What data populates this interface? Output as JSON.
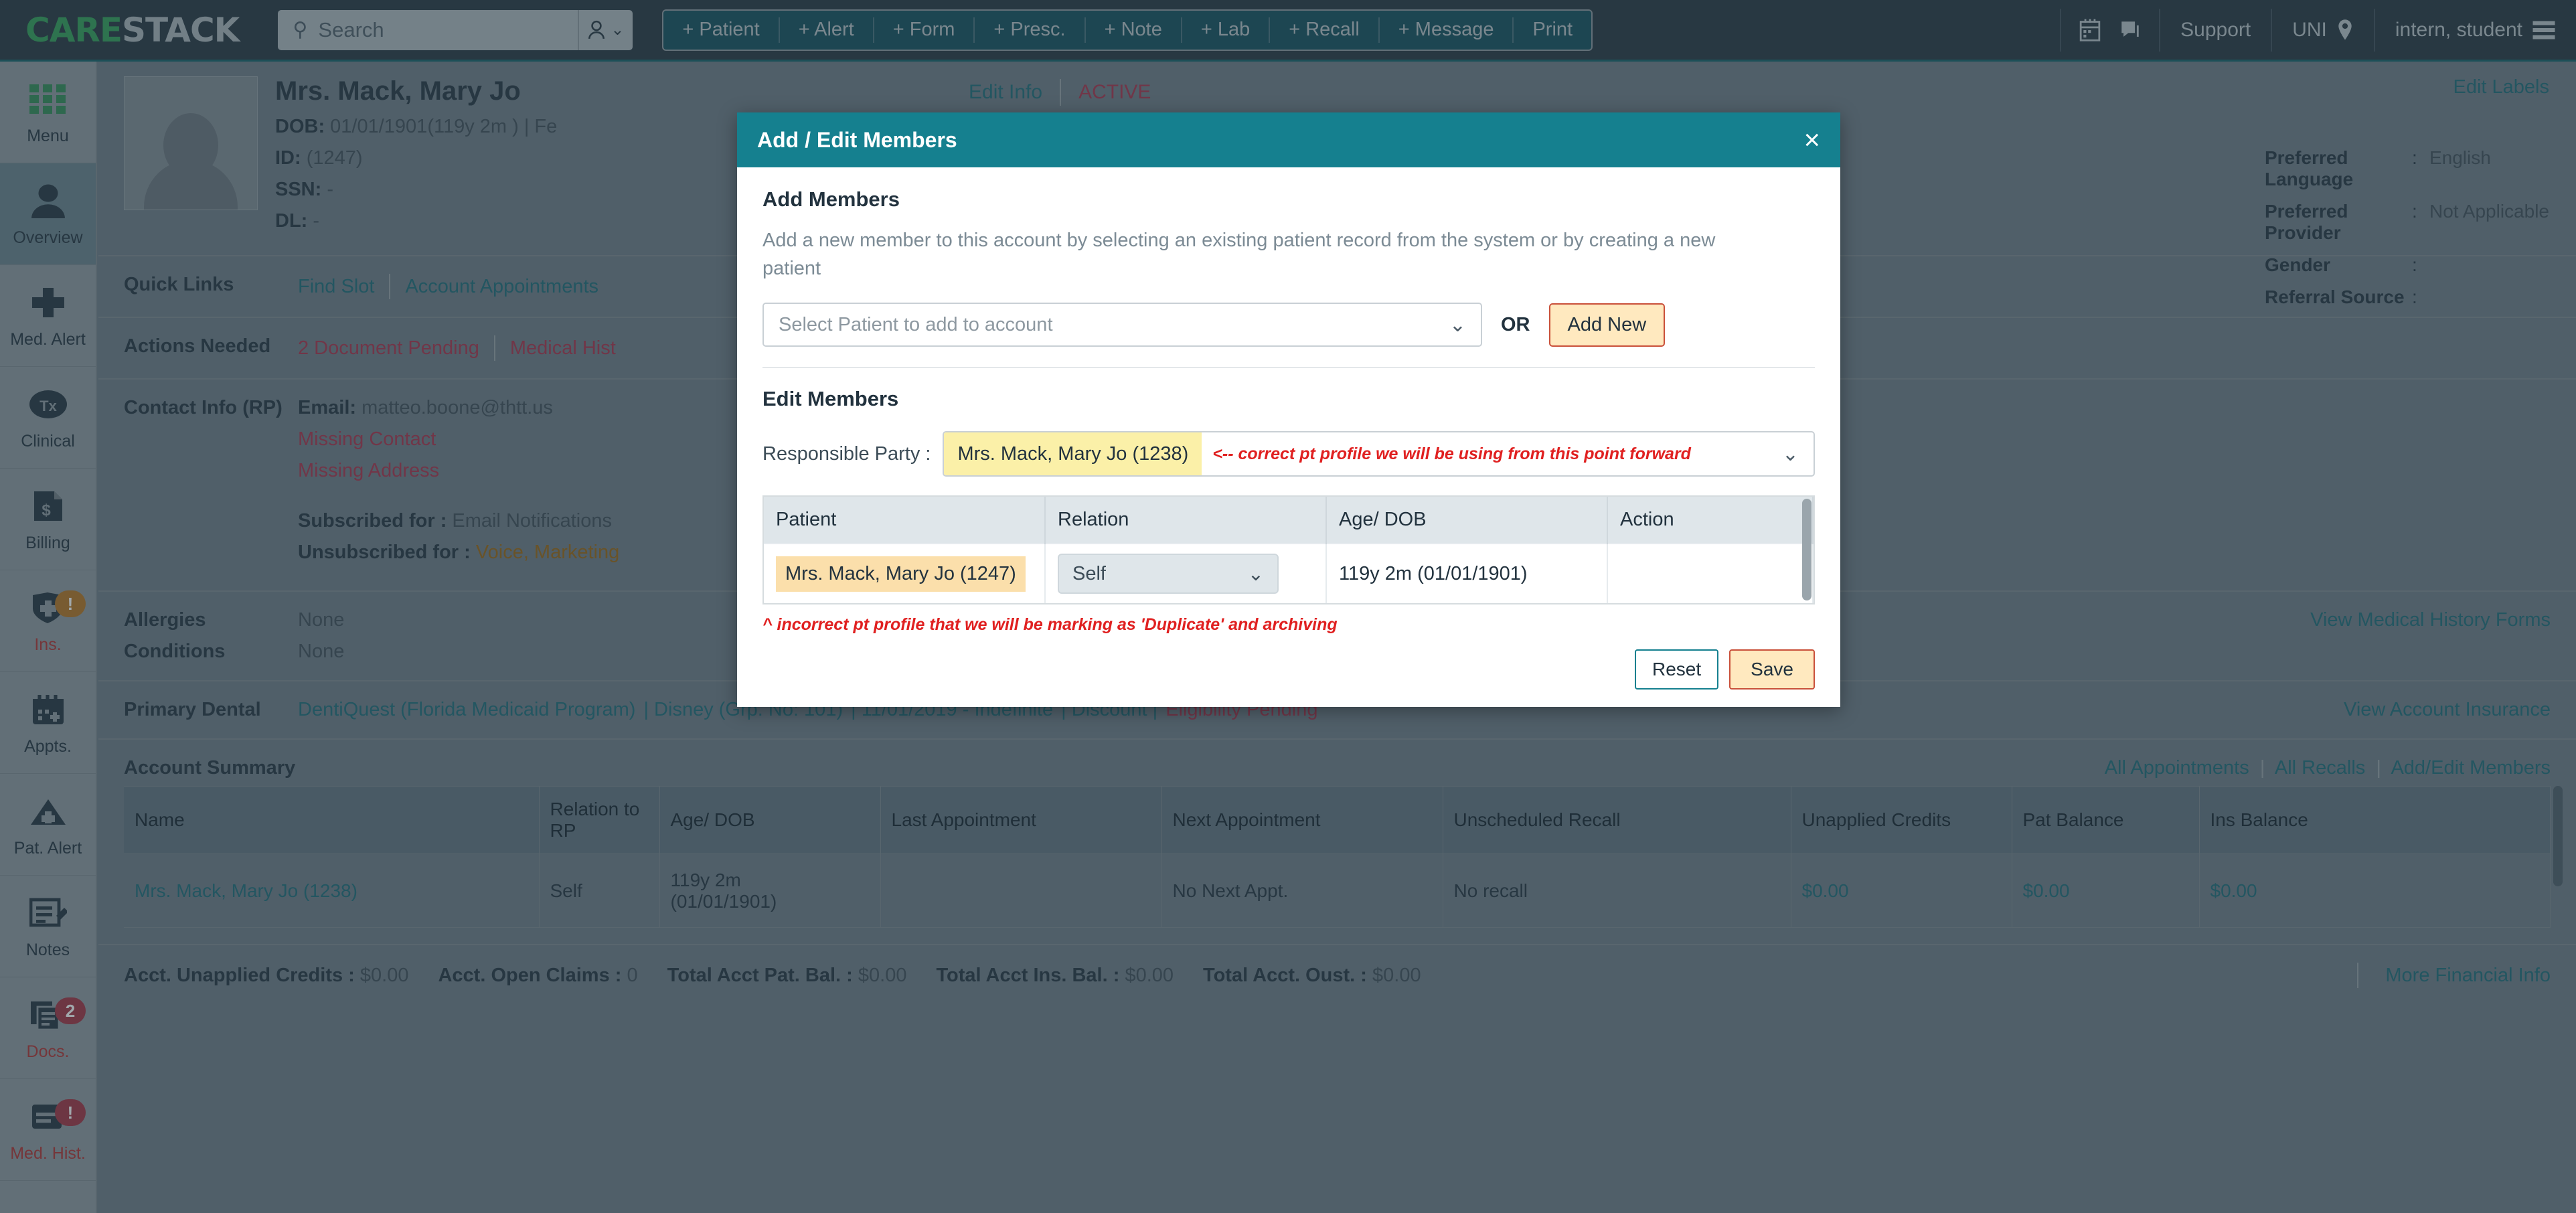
{
  "topbar": {
    "logo_care": "CARE",
    "logo_stack": "STACK",
    "search_placeholder": "Search",
    "quick_buttons": [
      "+ Patient",
      "+ Alert",
      "+ Form",
      "+ Presc.",
      "+ Note",
      "+ Lab",
      "+ Recall",
      "+ Message",
      "Print"
    ],
    "support_label": "Support",
    "location_label": "UNI",
    "user_label": "intern, student"
  },
  "rail": {
    "items": [
      {
        "label": "Menu",
        "icon": "grid-icon",
        "active": false,
        "warn": false,
        "badge": ""
      },
      {
        "label": "Overview",
        "icon": "person-icon",
        "active": true,
        "warn": false,
        "badge": ""
      },
      {
        "label": "Med. Alert",
        "icon": "plus-cross-icon",
        "active": false,
        "warn": false,
        "badge": ""
      },
      {
        "label": "Clinical",
        "icon": "tx-circle-icon",
        "active": false,
        "warn": false,
        "badge": ""
      },
      {
        "label": "Billing",
        "icon": "dollar-doc-icon",
        "active": false,
        "warn": false,
        "badge": ""
      },
      {
        "label": "Ins.",
        "icon": "shield-plus-icon",
        "active": false,
        "warn": true,
        "badge": "!"
      },
      {
        "label": "Appts.",
        "icon": "calendar-plus-icon",
        "active": false,
        "warn": false,
        "badge": ""
      },
      {
        "label": "Pat. Alert",
        "icon": "triangle-plus-icon",
        "active": false,
        "warn": false,
        "badge": ""
      },
      {
        "label": "Notes",
        "icon": "note-edit-icon",
        "active": false,
        "warn": false,
        "badge": ""
      },
      {
        "label": "Docs.",
        "icon": "documents-icon",
        "active": false,
        "warn": true,
        "badge": "2"
      },
      {
        "label": "Med. Hist.",
        "icon": "history-card-icon",
        "active": false,
        "warn": true,
        "badge": "!"
      }
    ]
  },
  "patient": {
    "name": "Mrs. Mack, Mary Jo",
    "dob_label": "DOB:",
    "dob_value": "01/01/1901(119y 2m ) | Fe",
    "id_label": "ID:",
    "id_value": "(1247)",
    "ssn_label": "SSN:",
    "ssn_value": "-",
    "dl_label": "DL:",
    "dl_value": "-",
    "edit_info": "Edit Info",
    "status": "ACTIVE",
    "edit_labels": "Edit Labels"
  },
  "right_panel": {
    "rows": [
      {
        "label": "Preferred Language",
        "sep": ":",
        "value": "English"
      },
      {
        "label": "Preferred Provider",
        "sep": ":",
        "value": "Not Applicable"
      },
      {
        "label": "Gender",
        "sep": ":",
        "value": ""
      },
      {
        "label": "Referral Source",
        "sep": ":",
        "value": ""
      }
    ]
  },
  "sections": {
    "quick_links": {
      "label": "Quick Links",
      "links": [
        "Find Slot",
        "Account Appointments"
      ]
    },
    "actions_needed": {
      "label": "Actions Needed",
      "items": [
        "2 Document Pending",
        "Medical Hist"
      ]
    },
    "contact_info": {
      "label": "Contact Info (RP)",
      "email_label": "Email:",
      "email_value": "matteo.boone@thtt.us",
      "missing_contact": "Missing Contact",
      "missing_address": "Missing Address",
      "subscribed_label": "Subscribed for :",
      "subscribed_value": "Email Notifications",
      "unsubscribed_label": "Unsubscribed for :",
      "unsubscribed_value": "Voice, Marketing"
    },
    "allergies": {
      "label": "Allergies",
      "value": "None"
    },
    "conditions": {
      "label": "Conditions",
      "value": "None"
    },
    "primary_dental": {
      "label": "Primary Dental",
      "plan": "DentiQuest (Florida Medicaid Program)",
      "group": "| Disney (Grp. No: 101)",
      "dates": "| 11/01/2019 - Indefinite",
      "discount": "| Discount |",
      "eligibility": "Eligibility Pending",
      "right_link": "View Account Insurance"
    },
    "medical_forms_link": "View Medical History Forms",
    "account_summary": {
      "label": "Account Summary",
      "links": [
        "All Appointments",
        "All Recalls",
        "Add/Edit Members"
      ],
      "columns": [
        "Name",
        "Relation to RP",
        "Age/ DOB",
        "Last Appointment",
        "Next Appointment",
        "Unscheduled Recall",
        "Unapplied Credits",
        "Pat Balance",
        "Ins Balance"
      ],
      "rows": [
        {
          "name": "Mrs. Mack, Mary Jo (1238)",
          "relation": "Self",
          "age_dob": "119y 2m\n(01/01/1901)",
          "last_appt": "",
          "next_appt": "No Next Appt.",
          "recall": "No recall",
          "unapplied_credits": "$0.00",
          "pat_balance": "$0.00",
          "ins_balance": "$0.00"
        }
      ]
    },
    "financials": {
      "items": [
        {
          "label": "Acct. Unapplied Credits  :",
          "value": "$0.00"
        },
        {
          "label": "Acct. Open Claims  :",
          "value": "0"
        },
        {
          "label": "Total Acct Pat. Bal.  :",
          "value": "$0.00"
        },
        {
          "label": "Total Acct Ins. Bal.  :",
          "value": "$0.00"
        },
        {
          "label": "Total Acct. Oust.  :",
          "value": "$0.00"
        }
      ],
      "more_link": "More Financial Info"
    }
  },
  "modal": {
    "title": "Add / Edit Members",
    "close_label": "×",
    "add_members_heading": "Add Members",
    "add_members_desc": "Add a new member to this account by selecting an existing patient record from the system or by creating a new patient",
    "select_placeholder": "Select Patient to add to account",
    "or_label": "OR",
    "add_new_label": "Add New",
    "edit_members_heading": "Edit Members",
    "responsible_party_label": "Responsible Party :",
    "responsible_party_value": "Mrs. Mack, Mary Jo (1238)",
    "responsible_party_annotation": "<-- correct pt profile we will be using from this point forward",
    "table_columns": [
      "Patient",
      "Relation",
      "Age/ DOB",
      "Action"
    ],
    "table_rows": [
      {
        "patient": "Mrs. Mack, Mary Jo  (1247)",
        "relation": "Self",
        "age_dob": "119y 2m (01/01/1901)",
        "action": ""
      }
    ],
    "bottom_annotation": "^ incorrect pt profile that we will be marking as 'Duplicate' and archiving",
    "reset_label": "Reset",
    "save_label": "Save"
  },
  "colors": {
    "brand_teal": "#15808f",
    "topbar_dark": "#23333f",
    "logo_green": "#2e9e56",
    "danger_red": "#a8304a",
    "annotation_red": "#e02020",
    "highlight_yellow": "#fbf0a8",
    "highlight_orange": "#fbdfab"
  }
}
